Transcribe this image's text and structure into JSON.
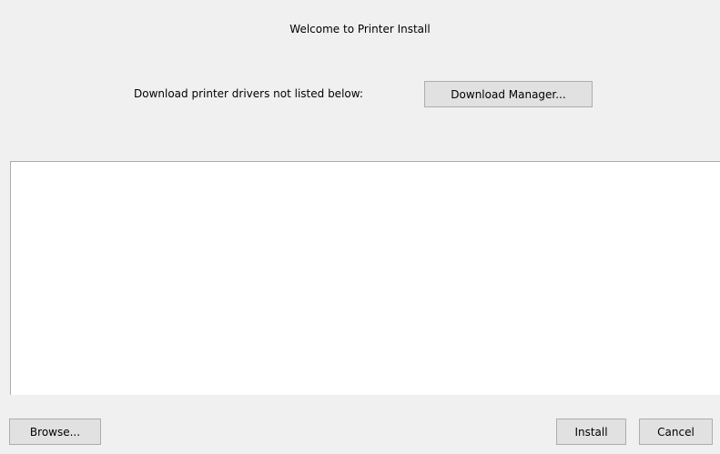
{
  "dialog": {
    "title": "Welcome to Printer Install"
  },
  "download": {
    "label": "Download printer drivers not listed below:",
    "button_label": "Download Manager..."
  },
  "driver_list": {
    "items": []
  },
  "footer": {
    "browse_label": "Browse...",
    "install_label": "Install",
    "cancel_label": "Cancel"
  }
}
